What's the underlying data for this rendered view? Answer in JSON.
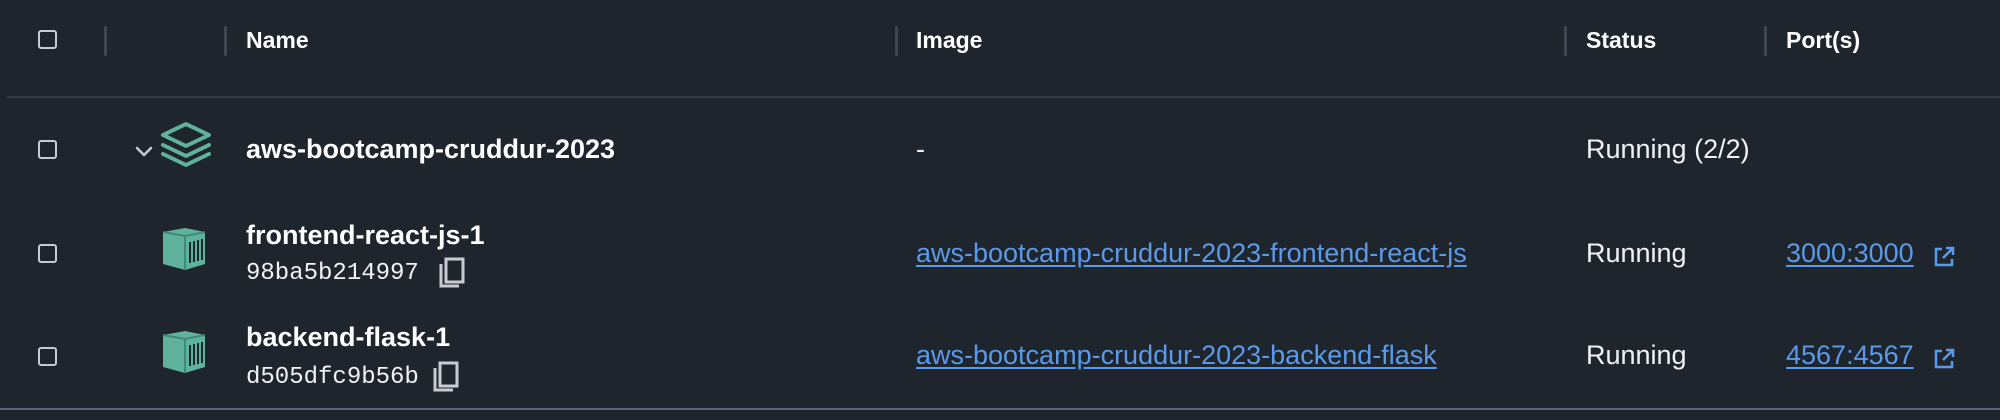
{
  "header": {
    "name": "Name",
    "image": "Image",
    "status": "Status",
    "ports": "Port(s)"
  },
  "rows": [
    {
      "kind": "compose-group",
      "icon": "layers-icon",
      "name": "aws-bootcamp-cruddur-2023",
      "image": "-",
      "status": "Running (2/2)"
    },
    {
      "kind": "container",
      "icon": "container-icon",
      "name": "frontend-react-js-1",
      "id": "98ba5b214997",
      "image": "aws-bootcamp-cruddur-2023-frontend-react-js",
      "status": "Running",
      "port": "3000:3000"
    },
    {
      "kind": "container",
      "icon": "container-icon",
      "name": "backend-flask-1",
      "id": "d505dfc9b56b",
      "image": "aws-bootcamp-cruddur-2023-backend-flask",
      "status": "Running",
      "port": "4567:4567"
    }
  ],
  "colors": {
    "background": "#1f252d",
    "icon_teal": "#5fb29c",
    "link": "#5b9ae8"
  }
}
